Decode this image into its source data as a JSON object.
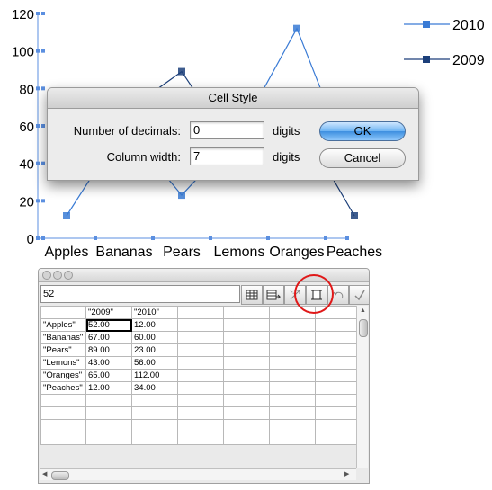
{
  "chart_data": {
    "type": "line",
    "categories": [
      "Apples",
      "Bananas",
      "Pears",
      "Lemons",
      "Oranges",
      "Peaches"
    ],
    "series": [
      {
        "name": "2010",
        "values": [
          12,
          60,
          23,
          56,
          112,
          34
        ],
        "color": "#3a7bd5"
      },
      {
        "name": "2009",
        "values": [
          52,
          67,
          89,
          43,
          65,
          12
        ],
        "color": "#1c3f7a"
      }
    ],
    "ylim": [
      0,
      120
    ],
    "yticks": [
      "0",
      "20",
      "40",
      "60",
      "80",
      "100",
      "120"
    ],
    "legend_position": "top-right",
    "grid": false
  },
  "dialog": {
    "title": "Cell Style",
    "decimals_label": "Number of decimals:",
    "decimals_value": "0",
    "decimals_unit": "digits",
    "width_label": "Column width:",
    "width_value": "7",
    "width_unit": "digits",
    "ok_label": "OK",
    "cancel_label": "Cancel"
  },
  "sheet": {
    "cell_value": "52",
    "headers": [
      "\"2009\"",
      "\"2010\""
    ],
    "rows": [
      {
        "label": "\"Apples\"",
        "v2009": "52.00",
        "v2010": "12.00"
      },
      {
        "label": "\"Bananas\"",
        "v2009": "67.00",
        "v2010": "60.00"
      },
      {
        "label": "\"Pears\"",
        "v2009": "89.00",
        "v2010": "23.00"
      },
      {
        "label": "\"Lemons\"",
        "v2009": "43.00",
        "v2010": "56.00"
      },
      {
        "label": "\"Oranges\"",
        "v2009": "65.00",
        "v2010": "112.00"
      },
      {
        "label": "\"Peaches\"",
        "v2009": "12.00",
        "v2010": "34.00"
      }
    ],
    "tools": [
      "import-table-icon",
      "export-table-icon",
      "transpose-icon",
      "cell-style-icon",
      "undo-icon",
      "apply-check-icon"
    ],
    "highlight_color": "#e01818"
  }
}
